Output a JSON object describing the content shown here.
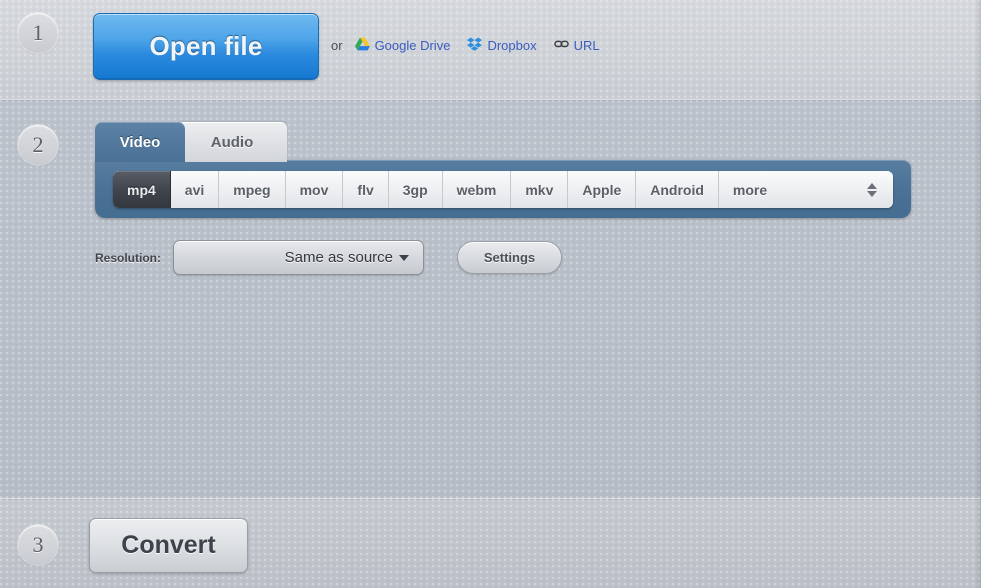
{
  "steps": {
    "one": "1",
    "two": "2",
    "three": "3"
  },
  "open": {
    "button_label": "Open file",
    "or_label": "or",
    "links": [
      {
        "label": "Google Drive",
        "icon": "google-drive-icon"
      },
      {
        "label": "Dropbox",
        "icon": "dropbox-icon"
      },
      {
        "label": "URL",
        "icon": "link-icon"
      }
    ]
  },
  "tabs": [
    {
      "label": "Video",
      "active": true
    },
    {
      "label": "Audio",
      "active": false
    }
  ],
  "formats": [
    {
      "label": "mp4",
      "selected": true
    },
    {
      "label": "avi",
      "selected": false
    },
    {
      "label": "mpeg",
      "selected": false
    },
    {
      "label": "mov",
      "selected": false
    },
    {
      "label": "flv",
      "selected": false
    },
    {
      "label": "3gp",
      "selected": false
    },
    {
      "label": "webm",
      "selected": false
    },
    {
      "label": "mkv",
      "selected": false
    },
    {
      "label": "Apple",
      "selected": false
    },
    {
      "label": "Android",
      "selected": false
    },
    {
      "label": "more",
      "selected": false
    }
  ],
  "options": {
    "resolution_label": "Resolution:",
    "resolution_value": "Same as source",
    "settings_label": "Settings"
  },
  "convert": {
    "button_label": "Convert"
  },
  "colors": {
    "accent_blue": "#2b8ade",
    "panel_blue": "#4a7296",
    "link_blue": "#3a5bbf",
    "background": "#b9bfc9",
    "selected_dark": "#41454d"
  }
}
